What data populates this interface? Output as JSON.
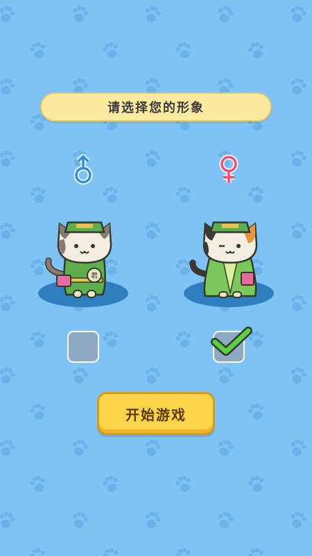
{
  "title": "请选择您的形象",
  "start_button": "开始游戏",
  "genders": [
    {
      "id": "male",
      "icon": "male-symbol-icon",
      "color": "#2b8fe0",
      "selected": false
    },
    {
      "id": "female",
      "icon": "female-symbol-icon",
      "color": "#f04a7a",
      "selected": true
    }
  ],
  "colors": {
    "background": "#7ec3f3",
    "title_bg": "#fbeaa0",
    "button_bg": "#fbd44a",
    "check": "#5ccf45"
  }
}
